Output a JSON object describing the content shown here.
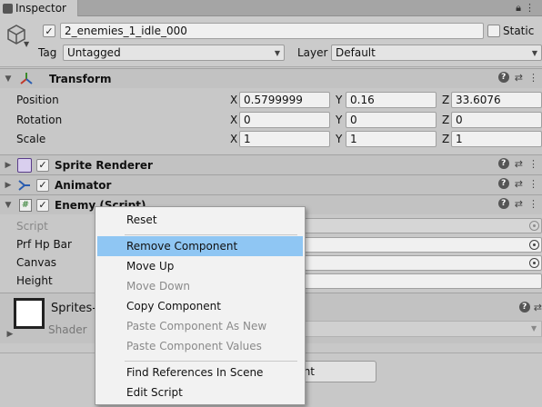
{
  "tab": {
    "title": "Inspector"
  },
  "gameobject": {
    "active": true,
    "name": "2_enemies_1_idle_000",
    "static_label": "Static",
    "static": false,
    "tag_label": "Tag",
    "tag_value": "Untagged",
    "layer_label": "Layer",
    "layer_value": "Default"
  },
  "transform": {
    "title": "Transform",
    "rows": [
      {
        "label": "Position",
        "x": "0.5799999",
        "y": "0.16",
        "z": "33.6076"
      },
      {
        "label": "Rotation",
        "x": "0",
        "y": "0",
        "z": "0"
      },
      {
        "label": "Scale",
        "x": "1",
        "y": "1",
        "z": "1"
      }
    ],
    "axes": [
      "X",
      "Y",
      "Z"
    ]
  },
  "sprite_renderer": {
    "title": "Sprite Renderer",
    "enabled": true
  },
  "animator": {
    "title": "Animator",
    "enabled": true
  },
  "enemy_script": {
    "title": "Enemy (Script)",
    "enabled": true,
    "fields": [
      {
        "label": "Script",
        "disabled": true
      },
      {
        "label": "Prf Hp Bar"
      },
      {
        "label": "Canvas"
      },
      {
        "label": "Height"
      }
    ]
  },
  "material": {
    "name": "Sprites-",
    "shader_label": "Shader"
  },
  "add_component": {
    "label_visible": "nt"
  },
  "context_menu": {
    "items": [
      {
        "label": "Reset",
        "state": "normal"
      },
      {
        "label": "Remove Component",
        "state": "highlight"
      },
      {
        "label": "Move Up",
        "state": "normal"
      },
      {
        "label": "Move Down",
        "state": "disabled"
      },
      {
        "label": "Copy Component",
        "state": "normal"
      },
      {
        "label": "Paste Component As New",
        "state": "disabled"
      },
      {
        "label": "Paste Component Values",
        "state": "disabled"
      },
      {
        "label": "Find References In Scene",
        "state": "normal"
      },
      {
        "label": "Edit Script",
        "state": "normal"
      }
    ]
  },
  "colors": {
    "highlight": "#8fc6f3",
    "panel": "#c8c8c8",
    "header": "#c2c2c2"
  },
  "icons": [
    "inspector-icon",
    "lock-icon",
    "menu-icon",
    "gameobject-cube-icon",
    "transform-icon",
    "sprite-renderer-icon",
    "animator-icon",
    "script-icon",
    "help-icon",
    "presets-icon",
    "more-icon",
    "object-picker-icon",
    "fold-arrow-icon"
  ]
}
